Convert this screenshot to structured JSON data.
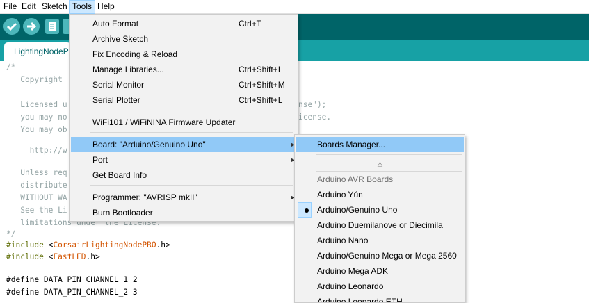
{
  "menubar": {
    "items": [
      "File",
      "Edit",
      "Sketch",
      "Tools",
      "Help"
    ],
    "active": "Tools"
  },
  "toolbar": {
    "buttons": [
      "verify-icon",
      "upload-icon",
      "new-icon",
      "open-icon"
    ]
  },
  "tab": {
    "label": "LightingNodePRO"
  },
  "editor": {
    "lines": [
      "/*",
      "   Copyright",
      "",
      "   Licensed u",
      "   you may no",
      "   You may ob",
      "",
      "     http://w",
      "",
      "   Unless req",
      "   distribute",
      "   WITHOUT WA",
      "   See the Li",
      "   limitations under the License.",
      "*/"
    ],
    "right_fragments": {
      "license_suffix": "nse\");",
      "license_suffix2": "icense."
    },
    "includes": [
      {
        "keyword": "#include",
        "open": " <",
        "lib": "CorsairLightingNodePRO",
        "close": ".h>"
      },
      {
        "keyword": "#include",
        "open": " <",
        "lib": "FastLED",
        "close": ".h>"
      }
    ],
    "defines": [
      "#define DATA_PIN_CHANNEL_1 2",
      "#define DATA_PIN_CHANNEL_2 3"
    ]
  },
  "tools_menu": {
    "items": [
      {
        "label": "Auto Format",
        "shortcut": "Ctrl+T"
      },
      {
        "label": "Archive Sketch",
        "shortcut": ""
      },
      {
        "label": "Fix Encoding & Reload",
        "shortcut": ""
      },
      {
        "label": "Manage Libraries...",
        "shortcut": "Ctrl+Shift+I"
      },
      {
        "label": "Serial Monitor",
        "shortcut": "Ctrl+Shift+M"
      },
      {
        "label": "Serial Plotter",
        "shortcut": "Ctrl+Shift+L"
      },
      {
        "label": "WiFi101 / WiFiNINA Firmware Updater",
        "shortcut": ""
      },
      {
        "label": "Board: \"Arduino/Genuino Uno\"",
        "shortcut": "",
        "submenu": true,
        "highlighted": true
      },
      {
        "label": "Port",
        "shortcut": "",
        "submenu": true
      },
      {
        "label": "Get Board Info",
        "shortcut": ""
      },
      {
        "label": "Programmer: \"AVRISP mkII\"",
        "shortcut": "",
        "submenu": true
      },
      {
        "label": "Burn Bootloader",
        "shortcut": ""
      }
    ],
    "submenu_arrow": "►"
  },
  "board_menu": {
    "manager": "Boards Manager...",
    "scroll_up": "△",
    "section_header": "Arduino AVR Boards",
    "boards": [
      "Arduino Yún",
      "Arduino/Genuino Uno",
      "Arduino Duemilanove or Diecimila",
      "Arduino Nano",
      "Arduino/Genuino Mega or Mega 2560",
      "Arduino Mega ADK",
      "Arduino Leonardo",
      "Arduino Leonardo ETH"
    ],
    "selected": "Arduino/Genuino Uno"
  },
  "colors": {
    "toolbar": "#006468",
    "tabstrip": "#17a1a5",
    "button": "#4db7bb",
    "highlight": "#91c9f7",
    "comment": "#95a5a6",
    "library": "#d35400"
  }
}
